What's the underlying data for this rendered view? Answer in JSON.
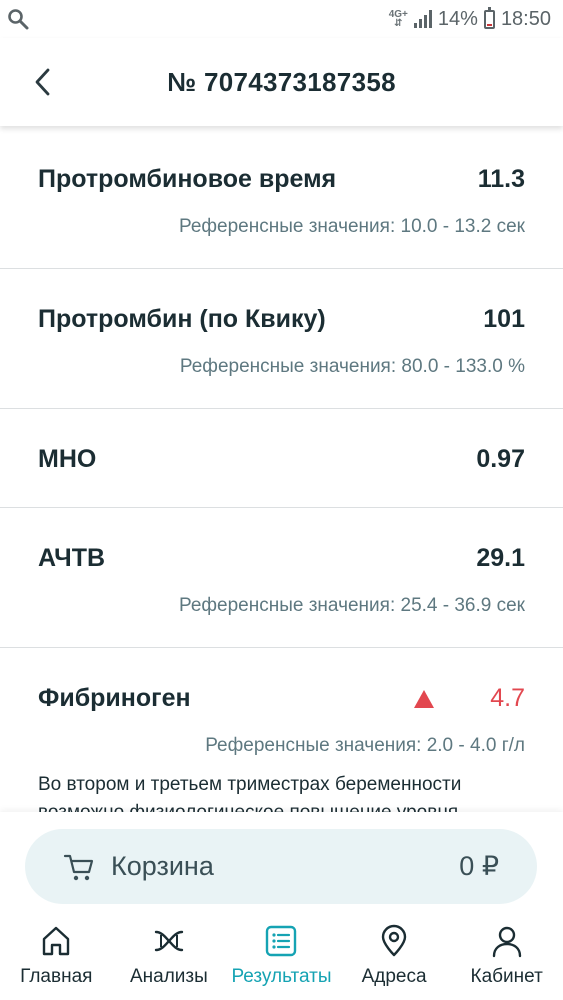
{
  "status_bar": {
    "network_top": "4G+",
    "battery_percent": "14%",
    "time": "18:50"
  },
  "header": {
    "title": "№ 7074373187358"
  },
  "results": [
    {
      "name": "Протромбиновое время",
      "value": "11.3",
      "reference": "Референсные значения: 10.0 - 13.2 сек"
    },
    {
      "name": "Протромбин (по Квику)",
      "value": "101",
      "reference": "Референсные значения: 80.0 - 133.0 %"
    },
    {
      "name": "МНО",
      "value": "0.97"
    },
    {
      "name": "АЧТВ",
      "value": "29.1",
      "reference": "Референсные значения: 25.4 - 36.9 сек"
    },
    {
      "name": "Фибриноген",
      "value": "4.7",
      "reference": "Референсные значения: 2.0 - 4.0 г/л",
      "note": "Во втором и третьем триместрах беременности возможно физиологическое повышение уровня"
    }
  ],
  "cart": {
    "label": "Корзина",
    "total": "0 ₽"
  },
  "tabs": [
    {
      "label": "Главная",
      "icon": "home-icon"
    },
    {
      "label": "Анализы",
      "icon": "dna-icon"
    },
    {
      "label": "Результаты",
      "icon": "results-list-icon"
    },
    {
      "label": "Адреса",
      "icon": "map-pin-icon"
    },
    {
      "label": "Кабинет",
      "icon": "user-icon"
    }
  ],
  "colors": {
    "accent": "#15a3b3",
    "alert": "#e2474f",
    "text": "#1b2d33",
    "muted": "#5e7880",
    "cart_bg": "#e9f3f5"
  }
}
